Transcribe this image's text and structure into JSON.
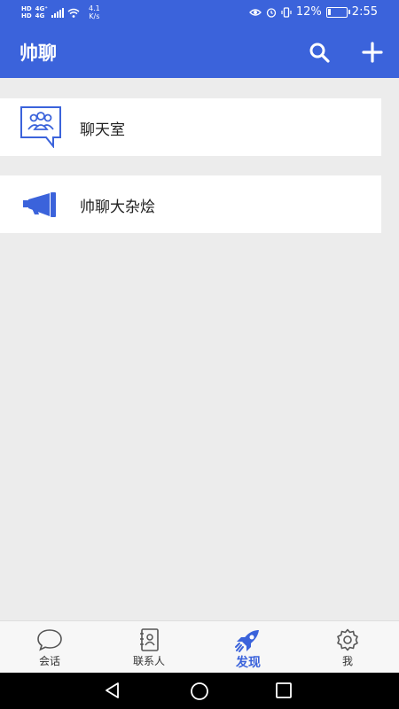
{
  "status_bar": {
    "network_badge_1": "HD",
    "network_badge_2": "HD",
    "net_type_1": "4G⁺",
    "net_type_2": "4G",
    "speed_value": "4.1",
    "speed_unit": "K/s",
    "battery": "12%",
    "time": "2:55"
  },
  "app_bar": {
    "title": "帅聊",
    "search_icon": "search-icon",
    "add_icon": "plus-icon"
  },
  "discover_items": [
    {
      "label": "聊天室",
      "icon": "chatroom-group-icon"
    },
    {
      "label": "帅聊大杂烩",
      "icon": "megaphone-icon"
    }
  ],
  "tabs": [
    {
      "label": "会话",
      "icon": "chat-bubble-icon"
    },
    {
      "label": "联系人",
      "icon": "contacts-book-icon"
    },
    {
      "label": "发现",
      "icon": "rocket-icon"
    },
    {
      "label": "我",
      "icon": "gear-icon"
    }
  ],
  "active_tab": "发现",
  "colors": {
    "brand": "#3b63db",
    "background": "#ececec",
    "tab_inactive": "#333333"
  },
  "nav_bar": {
    "back_icon": "back-triangle-icon",
    "home_icon": "home-circle-icon",
    "recents_icon": "recents-square-icon"
  }
}
